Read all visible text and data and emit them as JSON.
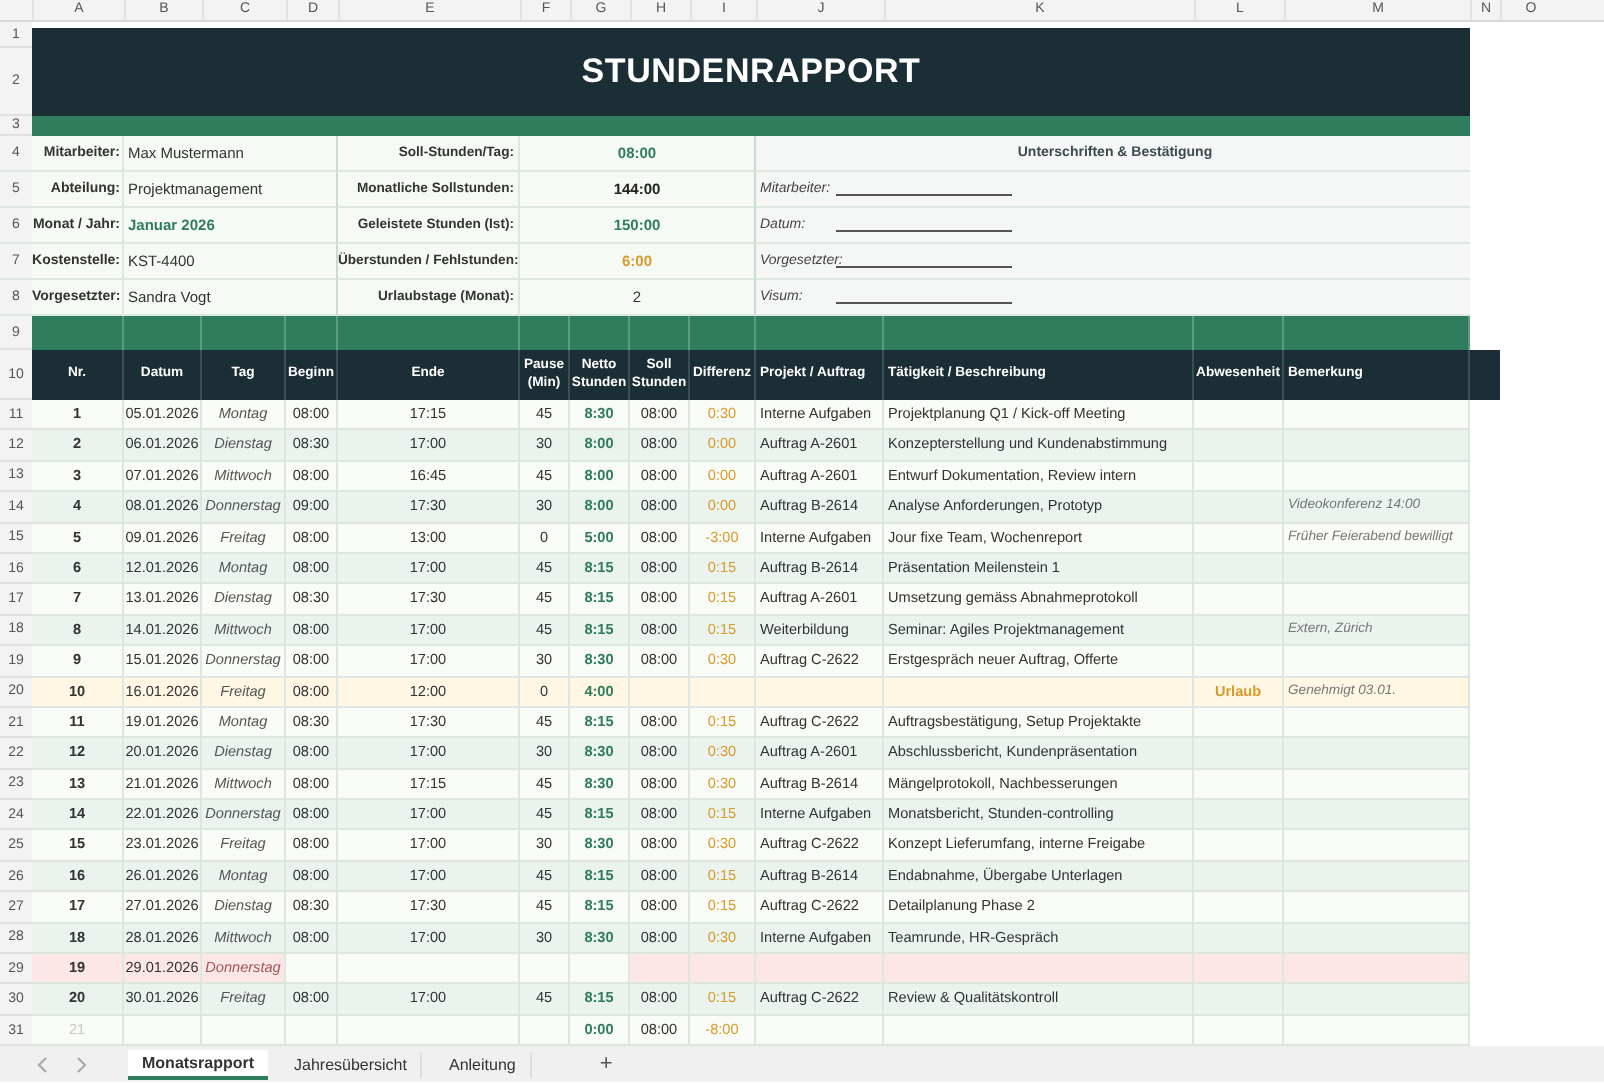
{
  "column_headers": [
    "A",
    "B",
    "C",
    "D",
    "E",
    "F",
    "G",
    "H",
    "I",
    "J",
    "K",
    "L",
    "M",
    "N",
    "O"
  ],
  "row_numbers": [
    "1",
    "2",
    "3",
    "4",
    "5",
    "6",
    "7",
    "8",
    "9",
    "10",
    "11",
    "12",
    "13",
    "14",
    "15",
    "16",
    "17",
    "18",
    "19",
    "20",
    "21",
    "22",
    "23",
    "24",
    "25",
    "26",
    "27",
    "28",
    "29",
    "30",
    "31"
  ],
  "title": "STUNDENRAPPORT",
  "info": [
    {
      "label": "Mitarbeiter:",
      "value": "Max Mustermann",
      "kind": "plain"
    },
    {
      "label": "Abteilung:",
      "value": "Projektmanagement",
      "kind": "plain"
    },
    {
      "label": "Monat / Jahr:",
      "value": "Januar 2026",
      "kind": "highlight"
    },
    {
      "label": "Kostenstelle:",
      "value": "KST-4400",
      "kind": "plain"
    },
    {
      "label": "Vorgesetzter:",
      "value": "Sandra Vogt",
      "kind": "plain"
    }
  ],
  "summary": [
    {
      "label": "Soll-Stunden/Tag:",
      "value": "08:00",
      "kind": "highlight"
    },
    {
      "label": "Monatliche Sollstunden:",
      "value": "144:00",
      "kind": "total"
    },
    {
      "label": "Geleistete Stunden (Ist):",
      "value": "150:00",
      "kind": "highlight"
    },
    {
      "label": "Überstunden / Fehlstunden:",
      "value": "6:00",
      "kind": "deviation"
    },
    {
      "label": "Urlaubstage (Monat):",
      "value": "2",
      "kind": "plain"
    }
  ],
  "signatures": {
    "title": "Unterschriften & Bestätigung",
    "lines": [
      "Mitarbeiter:",
      "Datum:",
      "Vorgesetzter:",
      "Visum:"
    ]
  },
  "table": {
    "columns": [
      "Nr.",
      "Datum",
      "Tag",
      "Beginn",
      "Ende",
      "Pause (Min)",
      "Netto Stunden",
      "Soll Stunden",
      "Differenz",
      "Projekt / Auftrag",
      "Tätigkeit / Beschreibung",
      "Abwesenheit",
      "Bemerkung"
    ],
    "rows": [
      {
        "kind": "work",
        "nr": "1",
        "date": "05.01.2026",
        "day": "Montag",
        "start": "08:00",
        "end": "17:15",
        "pause": "45",
        "net": "8:30",
        "target": "08:00",
        "diff": "0:30",
        "project": "Interne Aufgaben",
        "task": "Projektplanung Q1 / Kick-off Meeting"
      },
      {
        "kind": "work",
        "nr": "2",
        "date": "06.01.2026",
        "day": "Dienstag",
        "start": "08:30",
        "end": "17:00",
        "pause": "30",
        "net": "8:00",
        "target": "08:00",
        "diff": "0:00",
        "project": "Auftrag A-2601",
        "task": "Konzepterstellung und Kundenabstimmung"
      },
      {
        "kind": "work",
        "nr": "3",
        "date": "07.01.2026",
        "day": "Mittwoch",
        "start": "08:00",
        "end": "16:45",
        "pause": "45",
        "net": "8:00",
        "target": "08:00",
        "diff": "0:00",
        "project": "Auftrag A-2601",
        "task": "Entwurf Dokumentation, Review intern"
      },
      {
        "kind": "work",
        "nr": "4",
        "date": "08.01.2026",
        "day": "Donnerstag",
        "start": "09:00",
        "end": "17:30",
        "pause": "30",
        "net": "8:00",
        "target": "08:00",
        "diff": "0:00",
        "project": "Auftrag B-2614",
        "task": "Analyse Anforderungen, Prototyp",
        "note": "Videokonferenz 14:00"
      },
      {
        "kind": "work",
        "nr": "5",
        "date": "09.01.2026",
        "day": "Freitag",
        "start": "08:00",
        "end": "13:00",
        "pause": "0",
        "net": "5:00",
        "target": "08:00",
        "diff": "-3:00",
        "project": "Interne Aufgaben",
        "task": "Jour fixe Team, Wochenreport",
        "note": "Früher Feierabend bewilligt"
      },
      {
        "kind": "work",
        "nr": "6",
        "date": "12.01.2026",
        "day": "Montag",
        "start": "08:00",
        "end": "17:00",
        "pause": "45",
        "net": "8:15",
        "target": "08:00",
        "diff": "0:15",
        "project": "Auftrag B-2614",
        "task": "Präsentation Meilenstein 1"
      },
      {
        "kind": "work",
        "nr": "7",
        "date": "13.01.2026",
        "day": "Dienstag",
        "start": "08:30",
        "end": "17:30",
        "pause": "45",
        "net": "8:15",
        "target": "08:00",
        "diff": "0:15",
        "project": "Auftrag A-2601",
        "task": "Umsetzung gemäss Abnahmeprotokoll"
      },
      {
        "kind": "work",
        "nr": "8",
        "date": "14.01.2026",
        "day": "Mittwoch",
        "start": "08:00",
        "end": "17:00",
        "pause": "45",
        "net": "8:15",
        "target": "08:00",
        "diff": "0:15",
        "project": "Weiterbildung",
        "task": "Seminar: Agiles Projektmanagement",
        "note": "Extern, Zürich"
      },
      {
        "kind": "work",
        "nr": "9",
        "date": "15.01.2026",
        "day": "Donnerstag",
        "start": "08:00",
        "end": "17:00",
        "pause": "30",
        "net": "8:30",
        "target": "08:00",
        "diff": "0:30",
        "project": "Auftrag C-2622",
        "task": "Erstgespräch neuer Auftrag, Offerte"
      },
      {
        "kind": "vacation",
        "nr": "10",
        "date": "16.01.2026",
        "day": "Freitag",
        "start": "08:00",
        "end": "12:00",
        "pause": "0",
        "net": "4:00",
        "absence": "Urlaub",
        "note": "Genehmigt 03.01."
      },
      {
        "kind": "work",
        "nr": "11",
        "date": "19.01.2026",
        "day": "Montag",
        "start": "08:30",
        "end": "17:30",
        "pause": "45",
        "net": "8:15",
        "target": "08:00",
        "diff": "0:15",
        "project": "Auftrag C-2622",
        "task": "Auftragsbestätigung, Setup Projektakte"
      },
      {
        "kind": "work",
        "nr": "12",
        "date": "20.01.2026",
        "day": "Dienstag",
        "start": "08:00",
        "end": "17:00",
        "pause": "30",
        "net": "8:30",
        "target": "08:00",
        "diff": "0:30",
        "project": "Auftrag A-2601",
        "task": "Abschlussbericht, Kundenpräsentation"
      },
      {
        "kind": "work",
        "nr": "13",
        "date": "21.01.2026",
        "day": "Mittwoch",
        "start": "08:00",
        "end": "17:15",
        "pause": "45",
        "net": "8:30",
        "target": "08:00",
        "diff": "0:30",
        "project": "Auftrag B-2614",
        "task": "Mängelprotokoll, Nachbesserungen"
      },
      {
        "kind": "work",
        "nr": "14",
        "date": "22.01.2026",
        "day": "Donnerstag",
        "start": "08:00",
        "end": "17:00",
        "pause": "45",
        "net": "8:15",
        "target": "08:00",
        "diff": "0:15",
        "project": "Interne Aufgaben",
        "task": "Monatsbericht, Stunden-controlling"
      },
      {
        "kind": "work",
        "nr": "15",
        "date": "23.01.2026",
        "day": "Freitag",
        "start": "08:00",
        "end": "17:00",
        "pause": "30",
        "net": "8:30",
        "target": "08:00",
        "diff": "0:30",
        "project": "Auftrag C-2622",
        "task": "Konzept Lieferumfang, interne Freigabe"
      },
      {
        "kind": "work",
        "nr": "16",
        "date": "26.01.2026",
        "day": "Montag",
        "start": "08:00",
        "end": "17:00",
        "pause": "45",
        "net": "8:15",
        "target": "08:00",
        "diff": "0:15",
        "project": "Auftrag B-2614",
        "task": "Endabnahme, Übergabe Unterlagen"
      },
      {
        "kind": "work",
        "nr": "17",
        "date": "27.01.2026",
        "day": "Dienstag",
        "start": "08:30",
        "end": "17:30",
        "pause": "45",
        "net": "8:15",
        "target": "08:00",
        "diff": "0:15",
        "project": "Auftrag C-2622",
        "task": "Detailplanung Phase 2"
      },
      {
        "kind": "work",
        "nr": "18",
        "date": "28.01.2026",
        "day": "Mittwoch",
        "start": "08:00",
        "end": "17:00",
        "pause": "30",
        "net": "8:30",
        "target": "08:00",
        "diff": "0:30",
        "project": "Interne Aufgaben",
        "task": "Teamrunde, HR-Gespräch"
      },
      {
        "kind": "missing",
        "nr": "19",
        "date": "29.01.2026",
        "day": "Donnerstag"
      },
      {
        "kind": "work",
        "nr": "20",
        "date": "30.01.2026",
        "day": "Freitag",
        "start": "08:00",
        "end": "17:00",
        "pause": "45",
        "net": "8:15",
        "target": "08:00",
        "diff": "0:15",
        "project": "Auftrag C-2622",
        "task": "Review & Qualitätskontroll"
      },
      {
        "kind": "blank",
        "nr": "21",
        "net": "0:00",
        "target": "08:00",
        "diff": "-8:00"
      }
    ]
  },
  "sheet_tabs": [
    {
      "label": "Monatsrapport",
      "selected": true
    },
    {
      "label": "Jahresübersicht",
      "selected": false
    },
    {
      "label": "Anleitung",
      "selected": false
    }
  ],
  "add_sheet": "+"
}
